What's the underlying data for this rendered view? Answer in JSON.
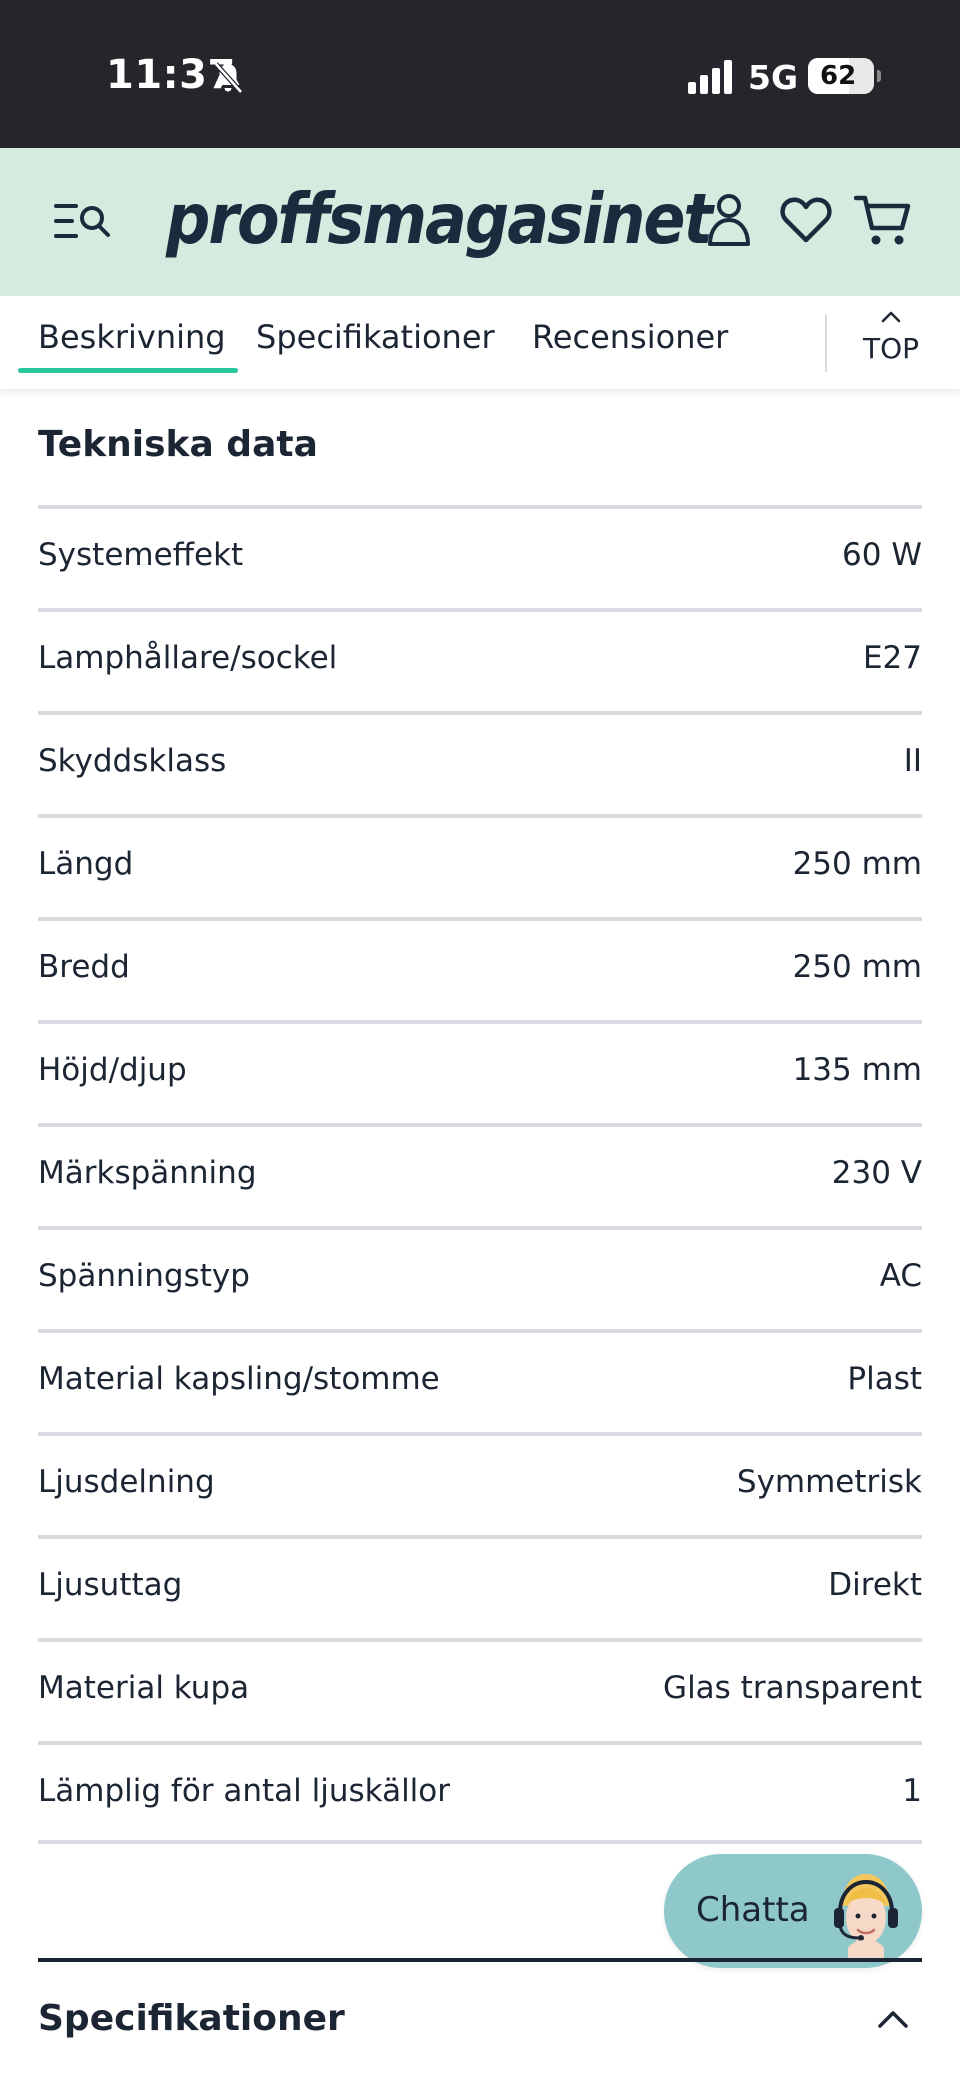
{
  "status_bar": {
    "time": "11:37",
    "network": "5G",
    "battery_percent": 62,
    "battery_label": "62"
  },
  "header": {
    "brand": "proffsmagasinet"
  },
  "tabs": [
    {
      "label": "Beskrivning",
      "active": true
    },
    {
      "label": "Specifikationer",
      "active": false
    },
    {
      "label": "Recensioner",
      "active": false
    }
  ],
  "top_button": {
    "label": "TOP"
  },
  "technical_data": {
    "title": "Tekniska data",
    "rows": [
      {
        "label": "Systemeffekt",
        "value": "60 W"
      },
      {
        "label": "Lamphållare/sockel",
        "value": "E27"
      },
      {
        "label": "Skyddsklass",
        "value": "II"
      },
      {
        "label": "Längd",
        "value": "250 mm"
      },
      {
        "label": "Bredd",
        "value": "250 mm"
      },
      {
        "label": "Höjd/djup",
        "value": "135 mm"
      },
      {
        "label": "Märkspänning",
        "value": "230 V"
      },
      {
        "label": "Spänningstyp",
        "value": "AC"
      },
      {
        "label": "Material kapsling/stomme",
        "value": "Plast"
      },
      {
        "label": "Ljusdelning",
        "value": "Symmetrisk"
      },
      {
        "label": "Ljusuttag",
        "value": "Direkt"
      },
      {
        "label": "Material kupa",
        "value": "Glas transparent"
      },
      {
        "label": "Lämplig för antal ljuskällor",
        "value": "1"
      }
    ]
  },
  "chat": {
    "label": "Chatta"
  },
  "collapsed_section": {
    "title": "Specifikationer"
  },
  "colors": {
    "header_bg": "#d5ebe0",
    "status_bar_bg": "#24262b",
    "tab_accent": "#27c79b",
    "chat_bg": "#8ec8cb",
    "text": "#1c2533"
  }
}
